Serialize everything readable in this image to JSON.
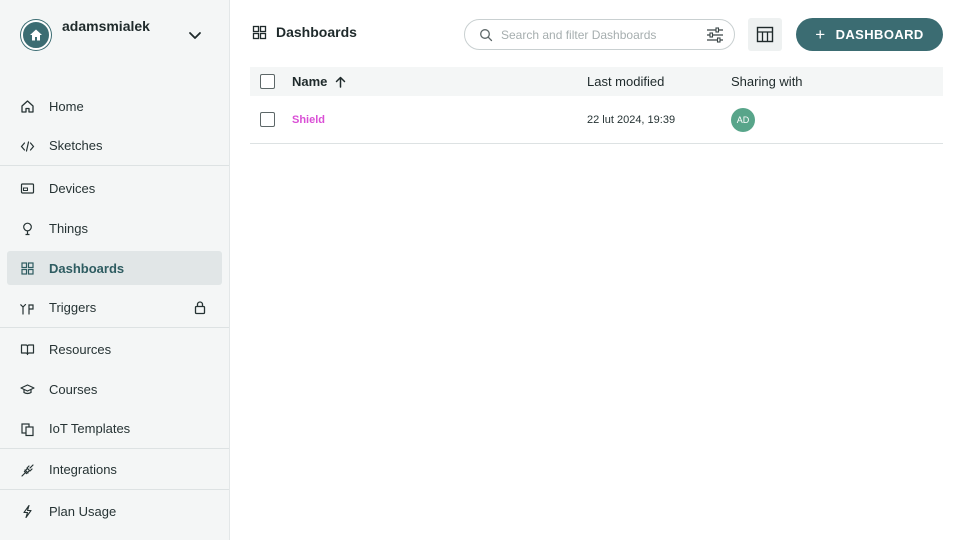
{
  "account": {
    "name": "adamsmialek"
  },
  "nav": {
    "items": [
      {
        "label": "Home",
        "icon": "home-icon"
      },
      {
        "label": "Sketches",
        "icon": "code-icon"
      },
      {
        "label": "Devices",
        "icon": "device-icon"
      },
      {
        "label": "Things",
        "icon": "thing-icon"
      },
      {
        "label": "Dashboards",
        "icon": "grid-icon",
        "active": true
      },
      {
        "label": "Triggers",
        "icon": "trigger-icon",
        "locked": true
      },
      {
        "label": "Resources",
        "icon": "book-icon"
      },
      {
        "label": "Courses",
        "icon": "graduation-cap-icon"
      },
      {
        "label": "IoT Templates",
        "icon": "templates-icon"
      },
      {
        "label": "Integrations",
        "icon": "plug-icon"
      },
      {
        "label": "Plan Usage",
        "icon": "lightning-icon"
      }
    ]
  },
  "header": {
    "title": "Dashboards",
    "search_placeholder": "Search and filter Dashboards",
    "add_label": "DASHBOARD"
  },
  "table": {
    "columns": {
      "name": "Name",
      "modified": "Last modified",
      "sharing": "Sharing with"
    },
    "rows": [
      {
        "name": "Shield",
        "modified": "22 lut 2024, 19:39",
        "sharing": "AD"
      }
    ]
  },
  "colors": {
    "accent": "#3b6c72",
    "link": "#da4fd6",
    "avatar": "#58a58a"
  }
}
